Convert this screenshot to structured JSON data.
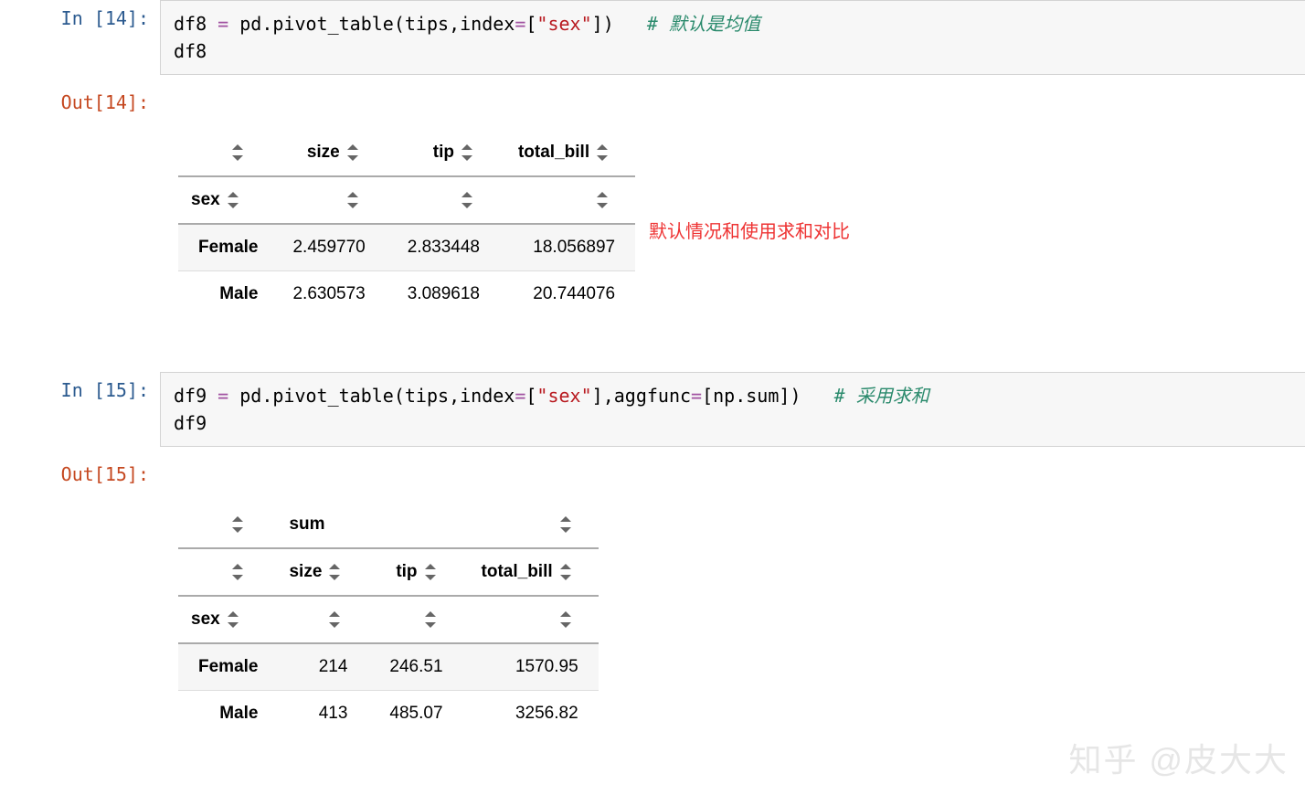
{
  "cells": [
    {
      "in_prompt": "In [14]:",
      "out_prompt": "Out[14]:",
      "code": {
        "var1": "df8",
        "assign": " = ",
        "mod": "pd",
        "dot1": ".",
        "func": "pivot_table",
        "open": "(",
        "arg1": "tips",
        "comma1": ",",
        "kw1": "index",
        "eq1": "=",
        "br1": "[",
        "str1": "\"sex\"",
        "br2": "]",
        "close": ")",
        "comment": "# 默认是均值",
        "line2": "df8"
      },
      "table": {
        "columns": [
          "size",
          "tip",
          "total_bill"
        ],
        "index_name": "sex",
        "rows": [
          {
            "idx": "Female",
            "vals": [
              "2.459770",
              "2.833448",
              "18.056897"
            ]
          },
          {
            "idx": "Male",
            "vals": [
              "2.630573",
              "3.089618",
              "20.744076"
            ]
          }
        ]
      },
      "annotation": "默认情况和使用求和对比"
    },
    {
      "in_prompt": "In [15]:",
      "out_prompt": "Out[15]:",
      "code": {
        "var1": "df9",
        "assign": " = ",
        "mod": "pd",
        "dot1": ".",
        "func": "pivot_table",
        "open": "(",
        "arg1": "tips",
        "comma1": ",",
        "kw1": "index",
        "eq1": "=",
        "br1": "[",
        "str1": "\"sex\"",
        "br2": "]",
        "comma2": ",",
        "kw2": "aggfunc",
        "eq2": "=",
        "br3": "[",
        "np": "np",
        "dot2": ".",
        "sum": "sum",
        "br4": "]",
        "close": ")",
        "comment": "# 采用求和",
        "line2": "df9"
      },
      "table": {
        "super_col": "sum",
        "columns": [
          "size",
          "tip",
          "total_bill"
        ],
        "index_name": "sex",
        "rows": [
          {
            "idx": "Female",
            "vals": [
              "214",
              "246.51",
              "1570.95"
            ]
          },
          {
            "idx": "Male",
            "vals": [
              "413",
              "485.07",
              "3256.82"
            ]
          }
        ]
      }
    }
  ],
  "watermark": "知乎 @皮大大"
}
